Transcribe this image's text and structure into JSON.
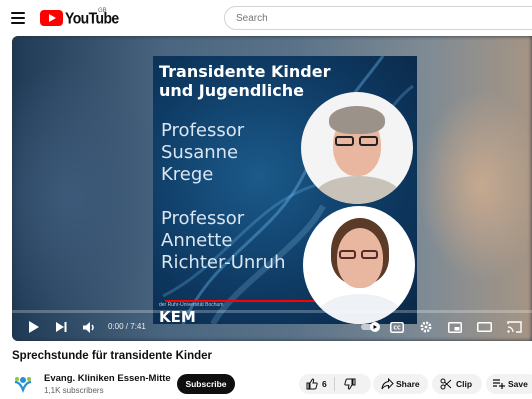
{
  "header": {
    "logo_text": "YouTube",
    "region": "GB",
    "search_placeholder": "Search"
  },
  "video": {
    "poster": {
      "title": "Transidente Kinder\nund Jugendliche",
      "speaker1": "Professor\nSusanne\nKrege",
      "speaker2": "Professor\nAnnette\nRichter-Unruh",
      "small_text": "der Ruhr-Universität Bochum",
      "brand": "KEM"
    },
    "time": "0:00 / 7:41",
    "progress": 0.0,
    "title": "Sprechstunde für transidente Kinder"
  },
  "channel": {
    "name": "Evang. Kliniken Essen-Mitte",
    "subscribers": "1,1K subscribers",
    "subscribe_label": "Subscribe"
  },
  "actions": {
    "likes": "6",
    "share_label": "Share",
    "clip_label": "Clip",
    "save_label": "Save"
  },
  "icons": [
    "menu-icon",
    "search-icon",
    "play-icon",
    "next-icon",
    "volume-icon",
    "autoplay-toggle-icon",
    "captions-icon",
    "settings-icon",
    "miniplayer-icon",
    "theater-icon",
    "cast-icon",
    "like-icon",
    "dislike-icon",
    "share-icon",
    "clip-icon",
    "save-icon"
  ],
  "colors": {
    "brand_red": "#ff0000",
    "dark": "#0f0f0f",
    "pill_bg": "#f2f2f2"
  }
}
